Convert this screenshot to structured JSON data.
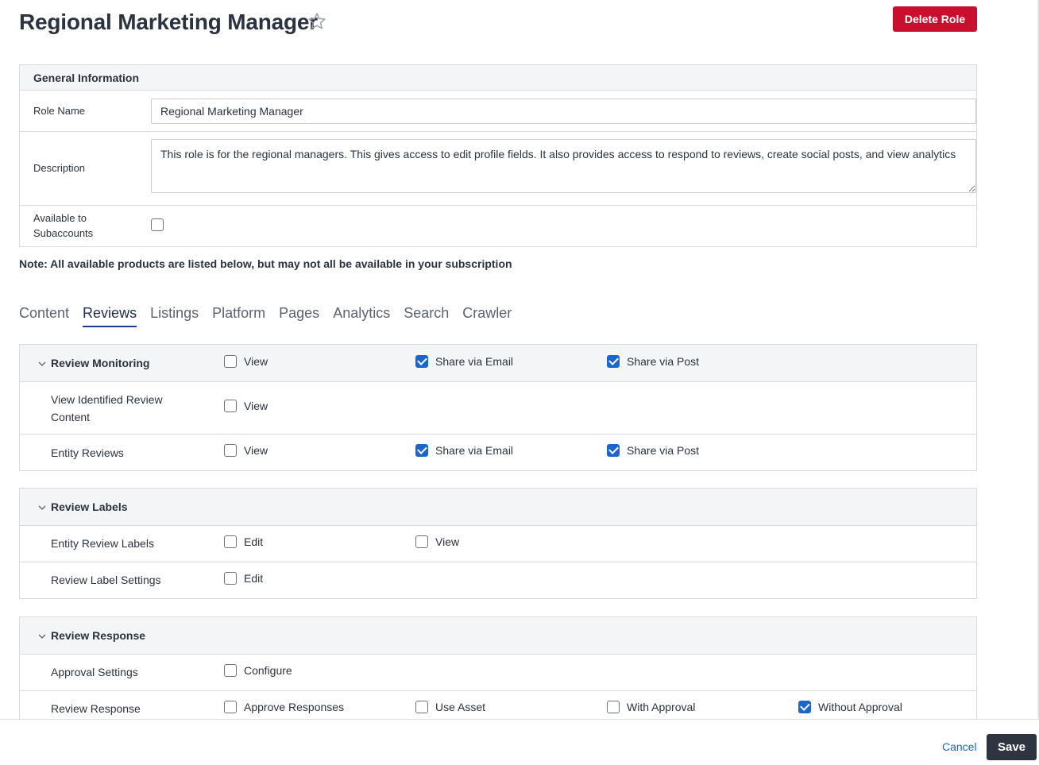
{
  "header": {
    "title": "Regional Marketing Manager",
    "delete_label": "Delete Role"
  },
  "general": {
    "heading": "General Information",
    "role_name_label": "Role Name",
    "role_name_value": "Regional Marketing Manager",
    "description_label": "Description",
    "description_value": "This role is for the regional managers. This gives access to edit profile fields. It also provides access to respond to reviews, create social posts, and view analytics",
    "available_label_line1": "Available to",
    "available_label_line2": "Subaccounts",
    "available_checked": false
  },
  "note": "Note: All available products are listed below, but may not all be available in your subscription",
  "tabs": [
    {
      "label": "Content",
      "active": false
    },
    {
      "label": "Reviews",
      "active": true
    },
    {
      "label": "Listings",
      "active": false
    },
    {
      "label": "Platform",
      "active": false
    },
    {
      "label": "Pages",
      "active": false
    },
    {
      "label": "Analytics",
      "active": false
    },
    {
      "label": "Search",
      "active": false
    },
    {
      "label": "Crawler",
      "active": false
    }
  ],
  "sections": {
    "review_monitoring": {
      "title": "Review Monitoring",
      "options": [
        {
          "label": "View",
          "checked": false
        },
        {
          "label": "Share via Email",
          "checked": true
        },
        {
          "label": "Share via Post",
          "checked": true
        }
      ],
      "rows": [
        {
          "label_line1": "View Identified Review",
          "label_line2": "Content",
          "options": [
            {
              "label": "View",
              "checked": false
            }
          ]
        },
        {
          "label": "Entity Reviews",
          "options": [
            {
              "label": "View",
              "checked": false
            },
            {
              "label": "Share via Email",
              "checked": true
            },
            {
              "label": "Share via Post",
              "checked": true
            }
          ]
        }
      ]
    },
    "review_labels": {
      "title": "Review Labels",
      "rows": [
        {
          "label": "Entity Review Labels",
          "options": [
            {
              "label": "Edit",
              "checked": false
            },
            {
              "label": "View",
              "checked": false
            }
          ]
        },
        {
          "label": "Review Label Settings",
          "options": [
            {
              "label": "Edit",
              "checked": false
            }
          ]
        }
      ]
    },
    "review_response": {
      "title": "Review Response",
      "rows": [
        {
          "label": "Approval Settings",
          "options": [
            {
              "label": "Configure",
              "checked": false
            }
          ]
        },
        {
          "label": "Review Response",
          "options": [
            {
              "label": "Approve Responses",
              "checked": false
            },
            {
              "label": "Use Asset",
              "checked": false
            },
            {
              "label": "With Approval",
              "checked": false
            },
            {
              "label": "Without Approval",
              "checked": true
            }
          ]
        }
      ]
    }
  },
  "footer": {
    "cancel_label": "Cancel",
    "save_label": "Save"
  },
  "colors": {
    "delete": "#c8102e",
    "checkbox_checked": "#1a66cc",
    "save": "#2f3540",
    "link": "#1a66cc"
  }
}
